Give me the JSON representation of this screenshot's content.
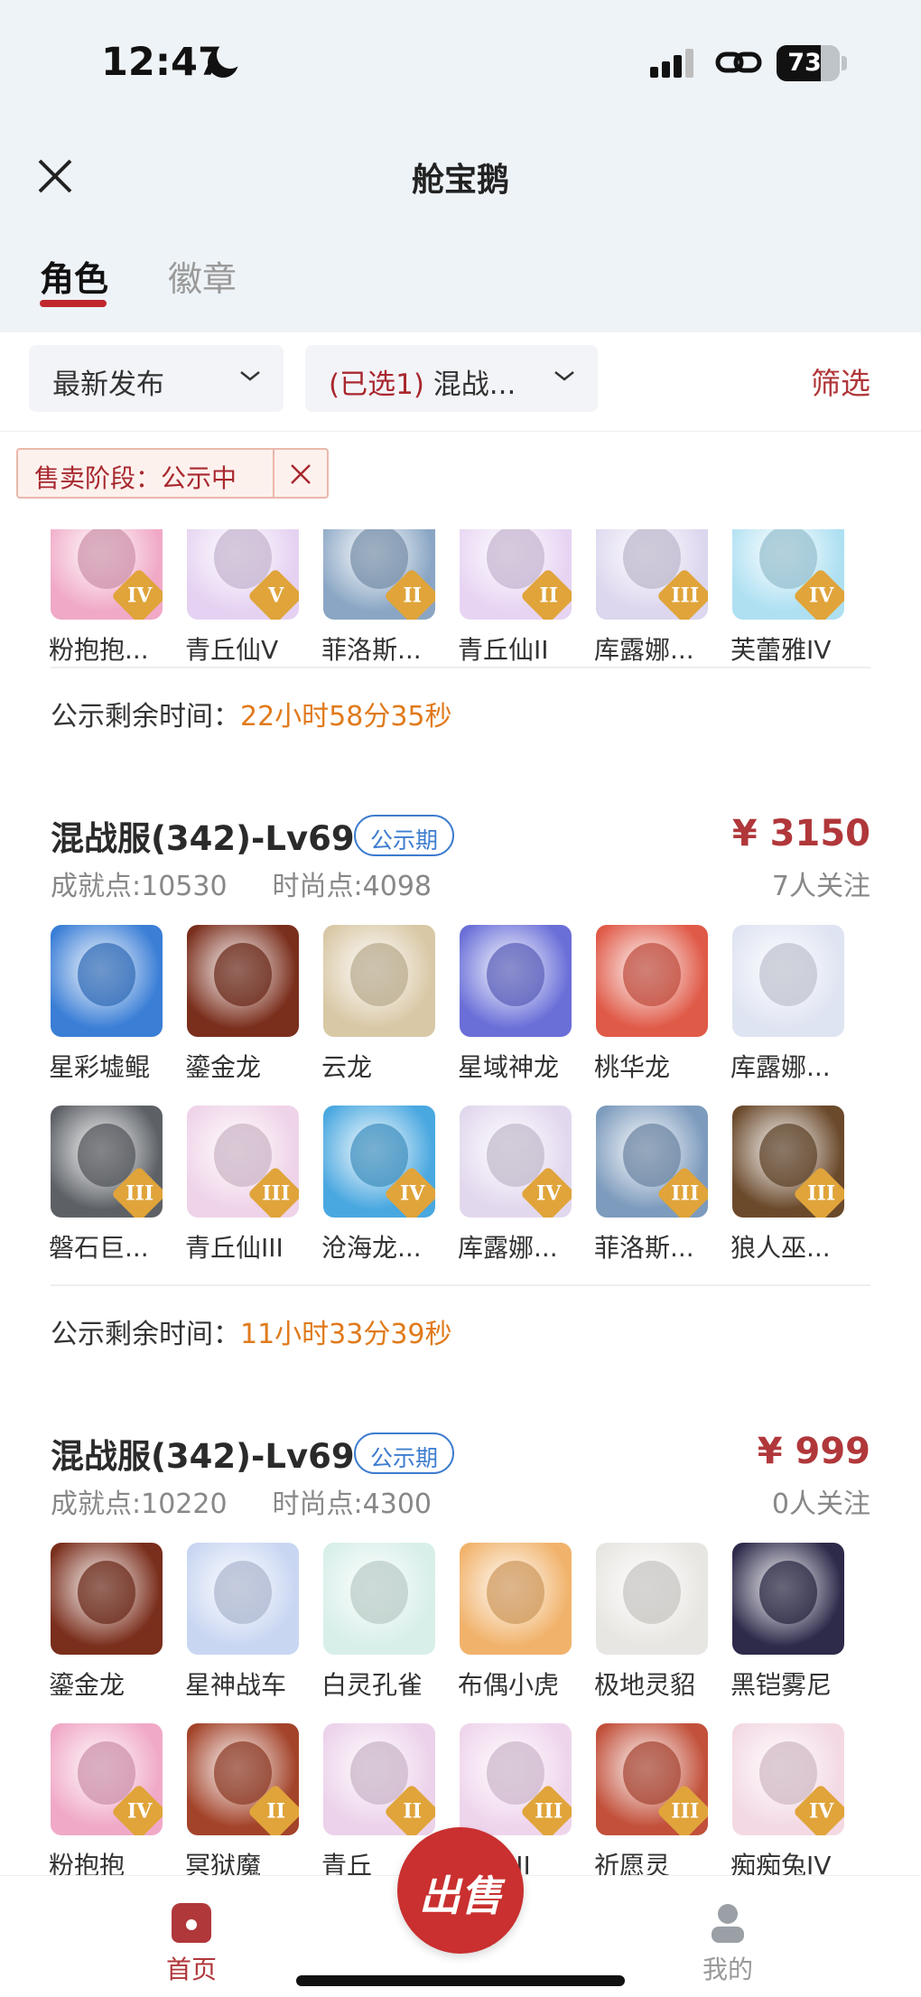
{
  "status_bar": {
    "time": "12:47",
    "battery": "73"
  },
  "navbar": {
    "title": "舱宝鹅"
  },
  "tabs": [
    {
      "label": "角色",
      "active": true
    },
    {
      "label": "徽章",
      "active": false
    }
  ],
  "filters": {
    "sort_label": "最新发布",
    "server_selected": "(已选1)",
    "server_label": "混战...",
    "screen_label": "筛选"
  },
  "active_chip": {
    "label": "售卖阶段：公示中"
  },
  "listings": [
    {
      "id": "partial",
      "items": [
        {
          "name": "粉抱抱...",
          "rank": "IV",
          "icon": "pink-bear-avatar",
          "color": "#f0a9c7"
        },
        {
          "name": "青丘仙V",
          "rank": "V",
          "icon": "fox-fairy-avatar",
          "color": "#e5d2f2"
        },
        {
          "name": "菲洛斯...",
          "rank": "II",
          "icon": "white-hair-mage-avatar",
          "color": "#8aa6c4"
        },
        {
          "name": "青丘仙II",
          "rank": "II",
          "icon": "fox-fairy-avatar",
          "color": "#e7d4f3"
        },
        {
          "name": "库露娜...",
          "rank": "III",
          "icon": "silver-hair-girl-avatar",
          "color": "#dcd6ee"
        },
        {
          "name": "芙蕾雅IV",
          "rank": "IV",
          "icon": "crowned-girl-avatar",
          "color": "#aee0f2"
        }
      ],
      "timer_label": "公示剩余时间：",
      "timer_value": "22小时58分35秒"
    },
    {
      "id": "listing-1",
      "title": "混战服(342)-Lv69",
      "badge": "公示期",
      "price": "¥ 3150",
      "achievement": "成就点:10530",
      "fashion": "时尚点:4098",
      "followers": "7人关注",
      "items": [
        {
          "name": "星彩墟鲲",
          "rank": "",
          "icon": "whale-mount",
          "color": "#3a7ed6"
        },
        {
          "name": "鎏金龙",
          "rank": "",
          "icon": "golden-dragon-mount",
          "color": "#7a2e1c"
        },
        {
          "name": "云龙",
          "rank": "",
          "icon": "cloud-dragon-mount",
          "color": "#d9c8a6"
        },
        {
          "name": "星域神龙",
          "rank": "",
          "icon": "star-dragon-mount",
          "color": "#6a6fd8"
        },
        {
          "name": "桃华龙",
          "rank": "",
          "icon": "peach-dragon-mount",
          "color": "#e05a48"
        },
        {
          "name": "库露娜...",
          "rank": "",
          "icon": "silver-hair-girl-avatar",
          "color": "#dfe4f2"
        },
        {
          "name": "磐石巨...",
          "rank": "III",
          "icon": "rock-giant-avatar",
          "color": "#5d6166"
        },
        {
          "name": "青丘仙III",
          "rank": "III",
          "icon": "fox-fairy-avatar",
          "color": "#efd3e8"
        },
        {
          "name": "沧海龙...",
          "rank": "IV",
          "icon": "sea-dragon-avatar",
          "color": "#4aa8e0"
        },
        {
          "name": "库露娜...",
          "rank": "IV",
          "icon": "silver-hair-girl-avatar",
          "color": "#e2d8ee"
        },
        {
          "name": "菲洛斯...",
          "rank": "III",
          "icon": "white-hair-mage-avatar",
          "color": "#7d9bbd"
        },
        {
          "name": "狼人巫...",
          "rank": "III",
          "icon": "werewolf-avatar",
          "color": "#6b4a2c"
        }
      ],
      "timer_label": "公示剩余时间：",
      "timer_value": "11小时33分39秒"
    },
    {
      "id": "listing-2",
      "title": "混战服(342)-Lv69",
      "badge": "公示期",
      "price": "¥ 999",
      "achievement": "成就点:10220",
      "fashion": "时尚点:4300",
      "followers": "0人关注",
      "items": [
        {
          "name": "鎏金龙",
          "rank": "",
          "icon": "golden-dragon-mount",
          "color": "#7a2e1c"
        },
        {
          "name": "星神战车",
          "rank": "",
          "icon": "star-chariot-mount",
          "color": "#c9d6f2"
        },
        {
          "name": "白灵孔雀",
          "rank": "",
          "icon": "white-peacock-mount",
          "color": "#d8efe9"
        },
        {
          "name": "布偶小虎",
          "rank": "",
          "icon": "plush-tiger-mount",
          "color": "#f1b36c"
        },
        {
          "name": "极地灵貂",
          "rank": "",
          "icon": "polar-ferret-mount",
          "color": "#e8e6e2"
        },
        {
          "name": "黑铠雾尼",
          "rank": "",
          "icon": "black-armor-mount",
          "color": "#2d2a4a"
        },
        {
          "name": "粉抱抱",
          "rank": "IV",
          "icon": "pink-bear-avatar",
          "color": "#f0a9c7"
        },
        {
          "name": "冥狱魔",
          "rank": "II",
          "icon": "underworld-demon-avatar",
          "color": "#a3432a"
        },
        {
          "name": "青丘",
          "rank": "II",
          "icon": "fox-fairy-avatar",
          "color": "#ecd2ea"
        },
        {
          "name": "丘仙III",
          "rank": "III",
          "icon": "fox-fairy-avatar",
          "color": "#efd5ec"
        },
        {
          "name": "祈愿灵",
          "rank": "III",
          "icon": "wish-spirit-avatar",
          "color": "#c2503a"
        },
        {
          "name": "痴痴兔IV",
          "rank": "IV",
          "icon": "bunny-avatar",
          "color": "#f3d9e4"
        }
      ]
    }
  ],
  "bottom_nav": {
    "home_label": "首页",
    "sell_label": "出售",
    "me_label": "我的"
  },
  "colors": {
    "accent": "#b0373a",
    "timer": "#e07a1b",
    "badge": "#3d7ccf"
  }
}
